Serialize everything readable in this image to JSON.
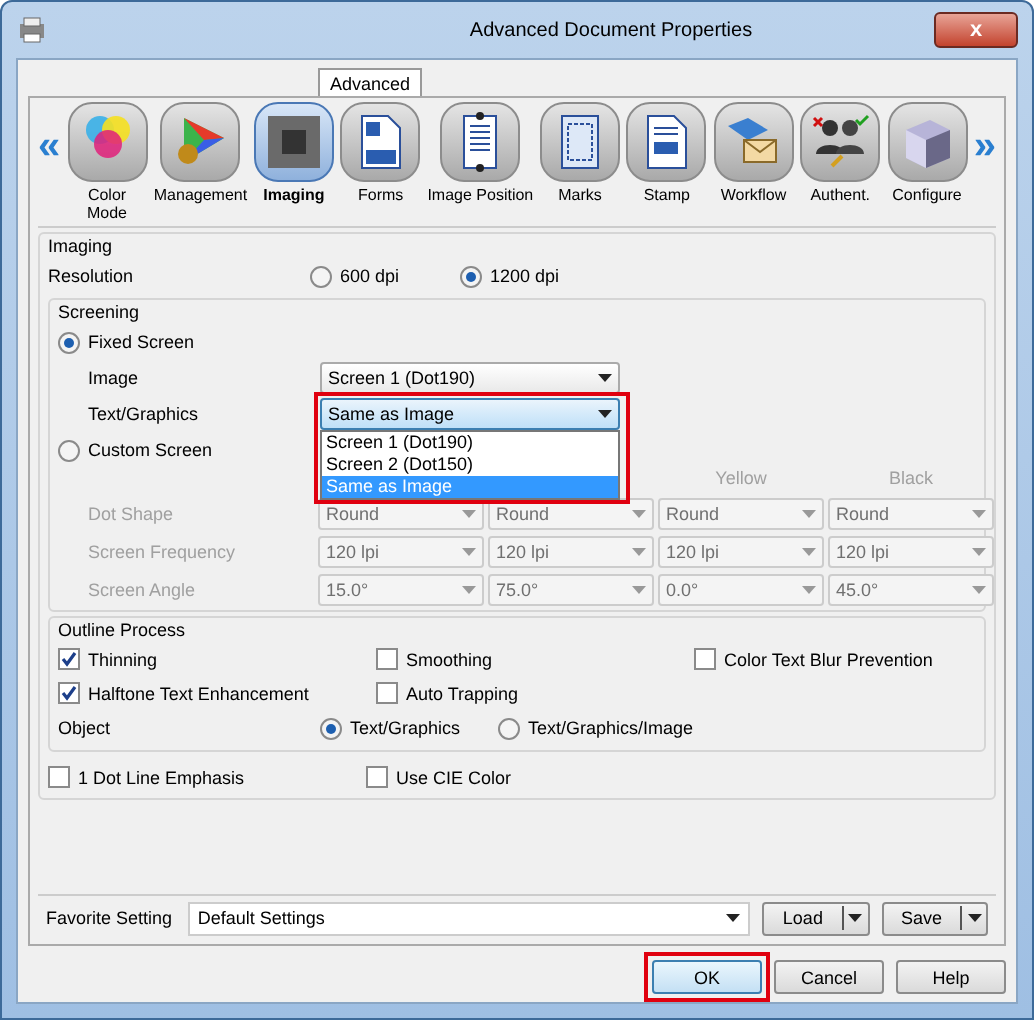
{
  "window": {
    "title": "Advanced Document Properties",
    "close": "x"
  },
  "tabs": [
    {
      "label": "Advanced",
      "selected": true
    }
  ],
  "toolbar": {
    "scroll_left": "«",
    "scroll_right": "»",
    "items": [
      {
        "label": "Color Mode",
        "kind": "color",
        "selected": false
      },
      {
        "label": "Management",
        "kind": "gamut",
        "selected": false
      },
      {
        "label": "Imaging",
        "kind": "imaging",
        "selected": true
      },
      {
        "label": "Forms",
        "kind": "forms",
        "selected": false
      },
      {
        "label": "Image Position",
        "kind": "position",
        "selected": false
      },
      {
        "label": "Marks",
        "kind": "marks",
        "selected": false
      },
      {
        "label": "Stamp",
        "kind": "stamp",
        "selected": false
      },
      {
        "label": "Workflow",
        "kind": "workflow",
        "selected": false
      },
      {
        "label": "Authent.",
        "kind": "auth",
        "selected": false
      },
      {
        "label": "Configure",
        "kind": "configure",
        "selected": false
      }
    ]
  },
  "imaging": {
    "title": "Imaging",
    "resolution": {
      "label": "Resolution",
      "options": [
        {
          "label": "600 dpi",
          "selected": false
        },
        {
          "label": "1200 dpi",
          "selected": true
        }
      ]
    },
    "screening": {
      "title": "Screening",
      "fixed": {
        "label": "Fixed Screen",
        "selected": true,
        "fields": [
          {
            "label": "Image",
            "value": "Screen 1 (Dot190)",
            "open": false
          },
          {
            "label": "Text/Graphics",
            "value": "Same as Image",
            "open": true,
            "options": [
              {
                "label": "Screen 1 (Dot190)",
                "selected": false
              },
              {
                "label": "Screen 2 (Dot150)",
                "selected": false
              },
              {
                "label": "Same as Image",
                "selected": true
              }
            ]
          }
        ]
      },
      "custom": {
        "label": "Custom Screen",
        "selected": false,
        "disabled": true,
        "headers": [
          "Yellow",
          "Black"
        ],
        "rows": [
          {
            "label": "Dot Shape",
            "values": [
              "Round",
              "Round",
              "Round",
              "Round"
            ]
          },
          {
            "label": "Screen Frequency",
            "values": [
              "120 lpi",
              "120 lpi",
              "120 lpi",
              "120 lpi"
            ]
          },
          {
            "label": "Screen Angle",
            "values": [
              "15.0°",
              "75.0°",
              "0.0°",
              "45.0°"
            ]
          }
        ]
      }
    },
    "outline": {
      "title": "Outline Process",
      "checks": [
        {
          "label": "Thinning",
          "checked": true
        },
        {
          "label": "Smoothing",
          "checked": false
        },
        {
          "label": "Color Text Blur Prevention",
          "checked": false
        },
        {
          "label": "Halftone Text Enhancement",
          "checked": true
        },
        {
          "label": "Auto Trapping",
          "checked": false
        }
      ],
      "object": {
        "label": "Object",
        "options": [
          {
            "label": "Text/Graphics",
            "selected": true
          },
          {
            "label": "Text/Graphics/Image",
            "selected": false
          }
        ]
      }
    },
    "extra_checks": [
      {
        "label": "1 Dot Line Emphasis",
        "checked": false
      },
      {
        "label": "Use CIE Color",
        "checked": false
      }
    ]
  },
  "favorite": {
    "label": "Favorite Setting",
    "value": "Default Settings",
    "buttons": [
      "Load",
      "Save"
    ]
  },
  "buttons": [
    {
      "label": "OK",
      "highlighted": true
    },
    {
      "label": "Cancel",
      "highlighted": false
    },
    {
      "label": "Help",
      "highlighted": false
    }
  ]
}
